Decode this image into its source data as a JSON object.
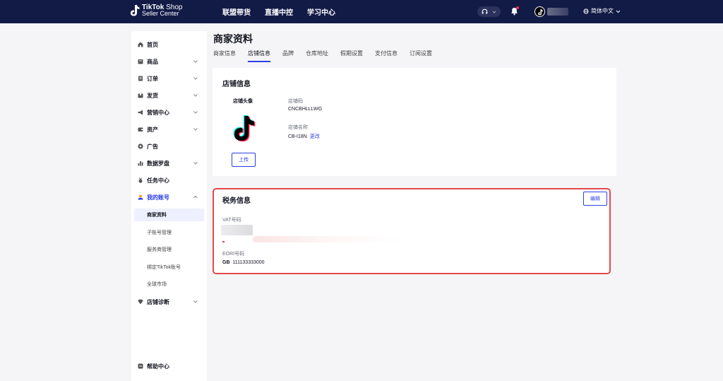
{
  "topbar": {
    "logo_line1": "TikTok",
    "logo_line1_suffix": "Shop",
    "logo_line2": "Seller Center",
    "nav": [
      "联盟带货",
      "直播中控",
      "学习中心"
    ],
    "language": "简体中文"
  },
  "sidebar": {
    "items": [
      {
        "label": "首页",
        "icon": "home-icon"
      },
      {
        "label": "商品",
        "icon": "product-icon"
      },
      {
        "label": "订单",
        "icon": "order-icon"
      },
      {
        "label": "发货",
        "icon": "shipping-icon"
      },
      {
        "label": "营销中心",
        "icon": "megaphone-icon"
      },
      {
        "label": "资产",
        "icon": "wallet-icon"
      },
      {
        "label": "广告",
        "icon": "ads-icon"
      },
      {
        "label": "数据罗盘",
        "icon": "chart-icon"
      },
      {
        "label": "任务中心",
        "icon": "medal-icon"
      },
      {
        "label": "我的账号",
        "icon": "user-icon"
      },
      {
        "label": "店铺诊断",
        "icon": "diamond-icon"
      }
    ],
    "account_sub_items": [
      "商家资料",
      "子账号管理",
      "服务商管理",
      "绑定TikTok账号",
      "全球市场"
    ],
    "help": "帮助中心"
  },
  "main": {
    "title": "商家资料",
    "tabs": [
      "商家信息",
      "店铺信息",
      "品牌",
      "仓库地址",
      "假期设置",
      "支付信息",
      "订阅设置"
    ],
    "active_tab": "店铺信息"
  },
  "shop_info": {
    "title": "店铺信息",
    "avatar_label": "店铺头像",
    "upload_button": "上传",
    "code_label": "店铺码",
    "code_value": "CNCBHLLLWG",
    "name_label": "店铺名称",
    "name_value": "CB-I18N",
    "edit_link": "更改"
  },
  "tax_info": {
    "title": "税务信息",
    "edit_button": "编辑",
    "vat_label": "VAT号码",
    "eori_label": "EORI号码",
    "eori_prefix": "GB",
    "eori_value": "111133333000"
  },
  "colors": {
    "topbar_bg": "#121a46",
    "accent": "#2d3fe8",
    "highlight_border": "#e24a4a"
  }
}
